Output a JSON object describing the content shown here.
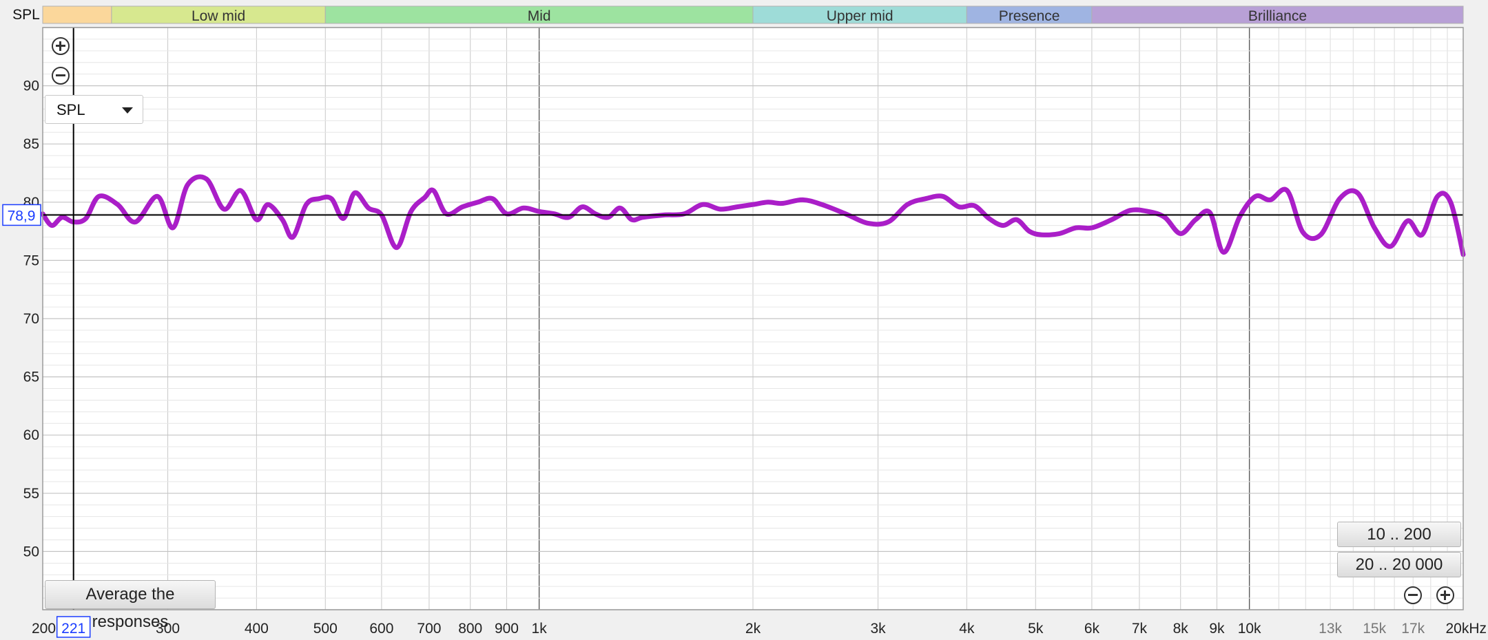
{
  "header": {
    "axis_unit": "SPL"
  },
  "bands": [
    {
      "label": "",
      "color": "#fbd79b",
      "from": 200,
      "to": 250
    },
    {
      "label": "Low mid",
      "color": "#d7e88f",
      "from": 250,
      "to": 500
    },
    {
      "label": "Mid",
      "color": "#9de3a0",
      "from": 500,
      "to": 2000
    },
    {
      "label": "Upper mid",
      "color": "#9edcd8",
      "from": 2000,
      "to": 4000
    },
    {
      "label": "Presence",
      "color": "#9fb4e2",
      "from": 4000,
      "to": 6000
    },
    {
      "label": "Brilliance",
      "color": "#b8a0d6",
      "from": 6000,
      "to": 20000
    }
  ],
  "cursor": {
    "spl_readout": "78,9",
    "freq_readout": "221",
    "spl": 78.9,
    "freq": 221
  },
  "controls": {
    "measurement_select": "SPL",
    "average_button": "Average the responses",
    "range_low_button": "10 .. 200",
    "range_full_button": "20 .. 20 000"
  },
  "colors": {
    "trace": "#aa1ec8",
    "cursor_readout": "#1a3cff",
    "grid_major": "#c8c8c8",
    "grid_minor": "#e2e2e2"
  },
  "chart_data": {
    "type": "line",
    "title": "",
    "xlabel": "",
    "ylabel": "SPL",
    "x_scale": "log",
    "xlim": [
      200,
      20000
    ],
    "ylim": [
      45,
      95
    ],
    "grid": true,
    "y_ticks": [
      50,
      55,
      60,
      65,
      70,
      75,
      80,
      85,
      90
    ],
    "x_ticks": [
      {
        "value": 200,
        "label": "200"
      },
      {
        "value": 300,
        "label": "300"
      },
      {
        "value": 400,
        "label": "400"
      },
      {
        "value": 500,
        "label": "500"
      },
      {
        "value": 600,
        "label": "600"
      },
      {
        "value": 700,
        "label": "700"
      },
      {
        "value": 800,
        "label": "800"
      },
      {
        "value": 900,
        "label": "900"
      },
      {
        "value": 1000,
        "label": "1k"
      },
      {
        "value": 2000,
        "label": "2k"
      },
      {
        "value": 3000,
        "label": "3k"
      },
      {
        "value": 4000,
        "label": "4k"
      },
      {
        "value": 5000,
        "label": "5k"
      },
      {
        "value": 6000,
        "label": "6k"
      },
      {
        "value": 7000,
        "label": "7k"
      },
      {
        "value": 8000,
        "label": "8k"
      },
      {
        "value": 9000,
        "label": "9k"
      },
      {
        "value": 10000,
        "label": "10k"
      },
      {
        "value": 13000,
        "label": "13k"
      },
      {
        "value": 15000,
        "label": "15k"
      },
      {
        "value": 17000,
        "label": "17k"
      },
      {
        "value": 20000,
        "label": "20kHz"
      }
    ],
    "series": [
      {
        "name": "",
        "color": "#aa1ec8",
        "points": [
          [
            200,
            79.0
          ],
          [
            206,
            78.0
          ],
          [
            213,
            78.7
          ],
          [
            221,
            78.3
          ],
          [
            230,
            78.6
          ],
          [
            240,
            80.5
          ],
          [
            255,
            79.8
          ],
          [
            270,
            78.3
          ],
          [
            290,
            80.5
          ],
          [
            305,
            77.8
          ],
          [
            320,
            81.5
          ],
          [
            340,
            82.0
          ],
          [
            360,
            79.4
          ],
          [
            380,
            81.0
          ],
          [
            400,
            78.5
          ],
          [
            415,
            79.8
          ],
          [
            435,
            78.5
          ],
          [
            450,
            77.0
          ],
          [
            470,
            79.8
          ],
          [
            490,
            80.3
          ],
          [
            510,
            80.3
          ],
          [
            530,
            78.6
          ],
          [
            550,
            80.8
          ],
          [
            575,
            79.5
          ],
          [
            600,
            78.9
          ],
          [
            630,
            76.1
          ],
          [
            660,
            79.2
          ],
          [
            690,
            80.4
          ],
          [
            710,
            81.0
          ],
          [
            740,
            79.0
          ],
          [
            780,
            79.6
          ],
          [
            820,
            80.0
          ],
          [
            860,
            80.3
          ],
          [
            900,
            79.0
          ],
          [
            950,
            79.5
          ],
          [
            1000,
            79.2
          ],
          [
            1050,
            79.0
          ],
          [
            1100,
            78.7
          ],
          [
            1150,
            79.6
          ],
          [
            1200,
            79.0
          ],
          [
            1250,
            78.7
          ],
          [
            1300,
            79.5
          ],
          [
            1350,
            78.5
          ],
          [
            1400,
            78.7
          ],
          [
            1500,
            78.9
          ],
          [
            1600,
            79.0
          ],
          [
            1700,
            79.8
          ],
          [
            1800,
            79.4
          ],
          [
            1900,
            79.6
          ],
          [
            2000,
            79.8
          ],
          [
            2100,
            80.0
          ],
          [
            2200,
            79.9
          ],
          [
            2350,
            80.2
          ],
          [
            2500,
            79.8
          ],
          [
            2700,
            79.0
          ],
          [
            2900,
            78.2
          ],
          [
            3100,
            78.3
          ],
          [
            3300,
            79.8
          ],
          [
            3500,
            80.3
          ],
          [
            3700,
            80.5
          ],
          [
            3900,
            79.6
          ],
          [
            4100,
            79.7
          ],
          [
            4300,
            78.6
          ],
          [
            4500,
            78.0
          ],
          [
            4700,
            78.5
          ],
          [
            4900,
            77.5
          ],
          [
            5100,
            77.2
          ],
          [
            5400,
            77.3
          ],
          [
            5700,
            77.8
          ],
          [
            6000,
            77.8
          ],
          [
            6400,
            78.5
          ],
          [
            6800,
            79.3
          ],
          [
            7200,
            79.2
          ],
          [
            7600,
            78.7
          ],
          [
            8000,
            77.3
          ],
          [
            8400,
            78.5
          ],
          [
            8800,
            79.1
          ],
          [
            9200,
            75.7
          ],
          [
            9700,
            78.8
          ],
          [
            10200,
            80.5
          ],
          [
            10700,
            80.2
          ],
          [
            11300,
            81.0
          ],
          [
            11900,
            77.4
          ],
          [
            12600,
            77.2
          ],
          [
            13400,
            80.3
          ],
          [
            14200,
            80.8
          ],
          [
            15000,
            77.8
          ],
          [
            15800,
            76.2
          ],
          [
            16700,
            78.4
          ],
          [
            17500,
            77.2
          ],
          [
            18400,
            80.5
          ],
          [
            19200,
            80.0
          ],
          [
            20000,
            75.5
          ]
        ]
      }
    ]
  }
}
